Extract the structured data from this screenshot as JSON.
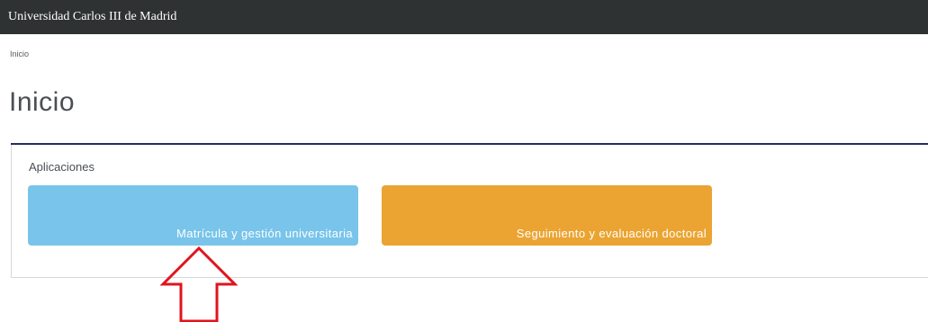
{
  "header": {
    "brand": "Universidad Carlos III de Madrid"
  },
  "breadcrumb": {
    "current": "Inicio"
  },
  "page": {
    "title": "Inicio"
  },
  "applications": {
    "heading": "Aplicaciones",
    "tiles": [
      {
        "label": "Matrícula y gestión universitaria",
        "color": "#79c4ea"
      },
      {
        "label": "Seguimiento y evaluación doctoral",
        "color": "#eba432"
      }
    ]
  },
  "annotation": {
    "icon": "up-arrow-outline-icon",
    "color": "#e0141e"
  },
  "colors": {
    "topbar": "#2f3233",
    "title_rule": "#1f2d6b"
  }
}
